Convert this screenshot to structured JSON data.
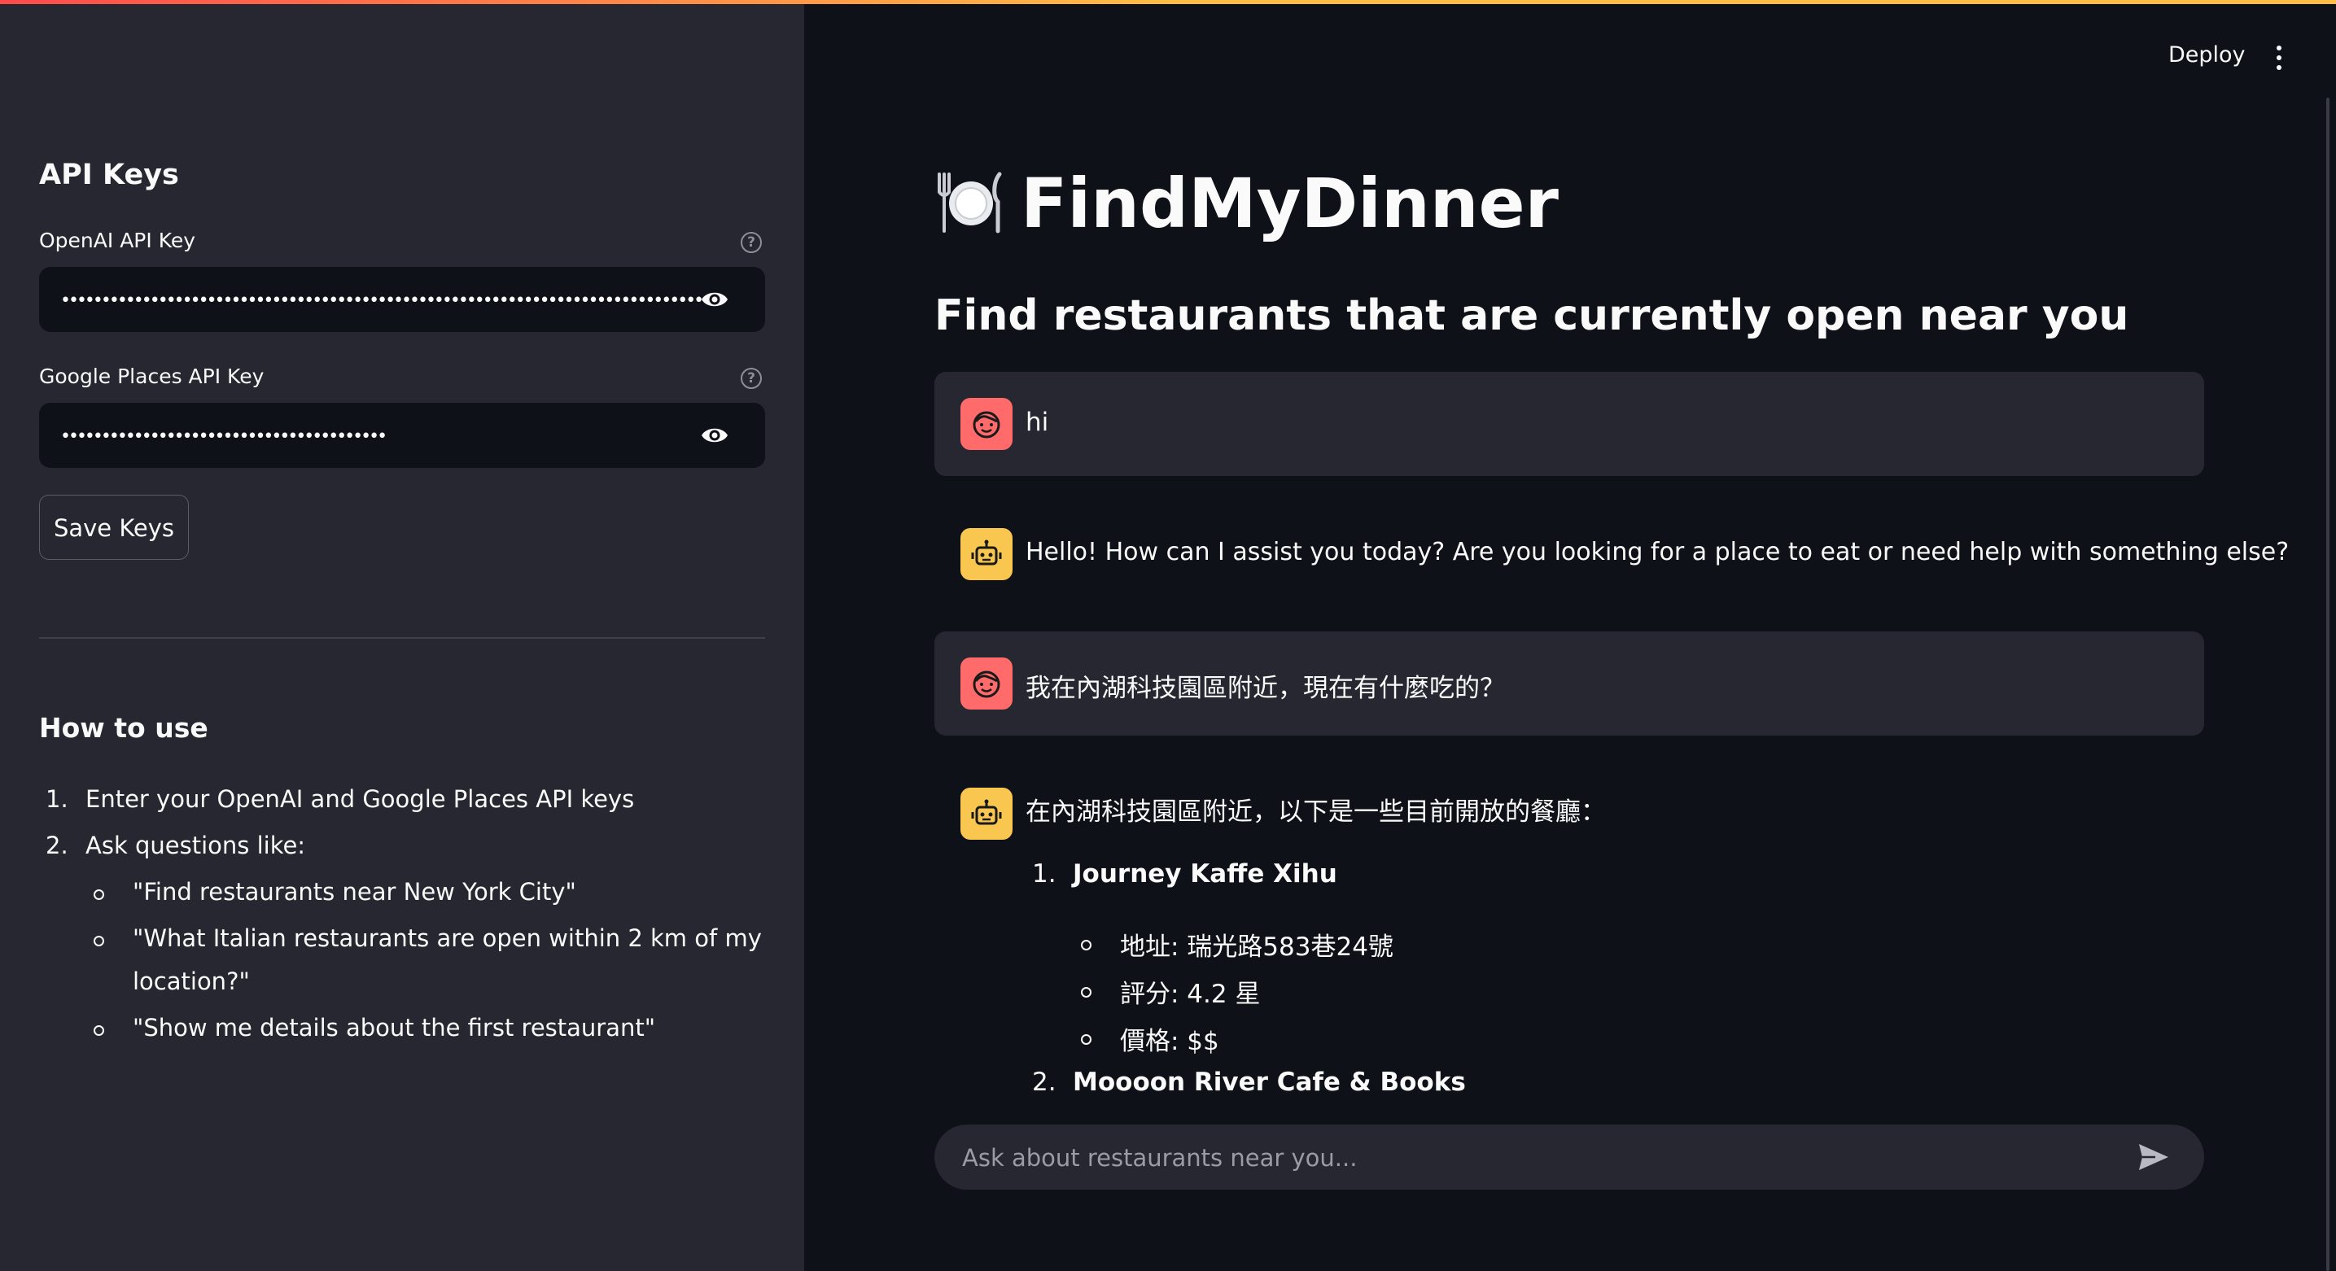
{
  "sidebar": {
    "api_keys_heading": "API Keys",
    "openai_label": "OpenAI API Key",
    "openai_value": "••••••••••••••••••••••••••••••••••••••••••••••••••••••••••••••••••••••••••••••••",
    "google_label": "Google Places API Key",
    "google_value": "••••••••••••••••••••••••••••••••••••••••",
    "save_button": "Save Keys",
    "how_to_heading": "How to use",
    "steps": [
      {
        "num": "1.",
        "text": "Enter your OpenAI and Google Places API keys"
      },
      {
        "num": "2.",
        "text": "Ask questions like:"
      }
    ],
    "examples": [
      "\"Find restaurants near New York City\"",
      "\"What Italian restaurants are open within 2 km of my",
      "location?\"",
      "\"Show me details about the first restaurant\""
    ]
  },
  "header": {
    "deploy": "Deploy",
    "menu_icon": "kebab-menu-icon"
  },
  "main": {
    "title": "FindMyDinner",
    "title_icon": "plate-cutlery-icon",
    "subtitle": "Find restaurants that are currently open near you",
    "messages": [
      {
        "role": "user",
        "text": "hi"
      },
      {
        "role": "assistant",
        "text": "Hello! How can I assist you today? Are you looking for a place to eat or need help with something else?"
      },
      {
        "role": "user",
        "text": "我在內湖科技園區附近，現在有什麼吃的？"
      },
      {
        "role": "assistant",
        "text": "在內湖科技園區附近，以下是一些目前開放的餐廳："
      }
    ],
    "restaurants": [
      {
        "num": "1.",
        "name": "Journey Kaffe Xihu",
        "details": [
          "地址: 瑞光路583巷24號",
          "評分: 4.2 星",
          "價格: $$"
        ]
      },
      {
        "num": "2.",
        "name": "Moooon River Cafe & Books"
      }
    ],
    "chat_placeholder": "Ask about restaurants near you..."
  },
  "colors": {
    "background": "#0e1117",
    "sidebar": "#262730",
    "accent_red": "#ff4b4b",
    "user_avatar": "#ff6b6b",
    "bot_avatar": "#f9c74f"
  }
}
